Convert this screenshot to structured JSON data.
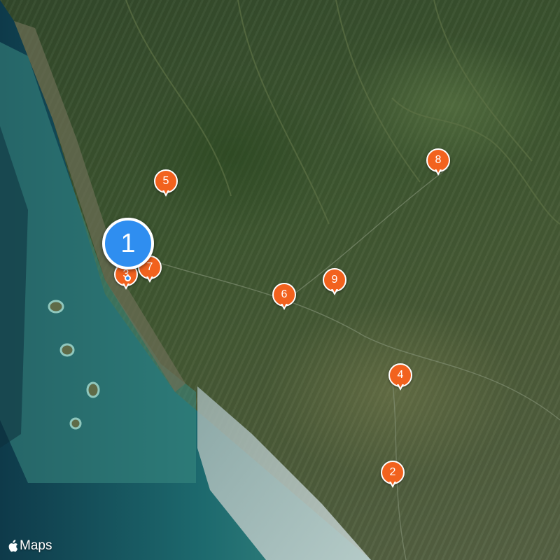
{
  "map": {
    "brand": "Maps",
    "brand_icon": "apple-logo-icon",
    "colors": {
      "pin_orange": "#f2621e",
      "pin_blue": "#2f8ef0",
      "sea_shallow": "#2f7f7a",
      "sea_deep": "#0e3a4a"
    },
    "selected_pin": "1",
    "pins": [
      "2",
      "3",
      "4",
      "5",
      "6",
      "7",
      "8",
      "9"
    ]
  }
}
